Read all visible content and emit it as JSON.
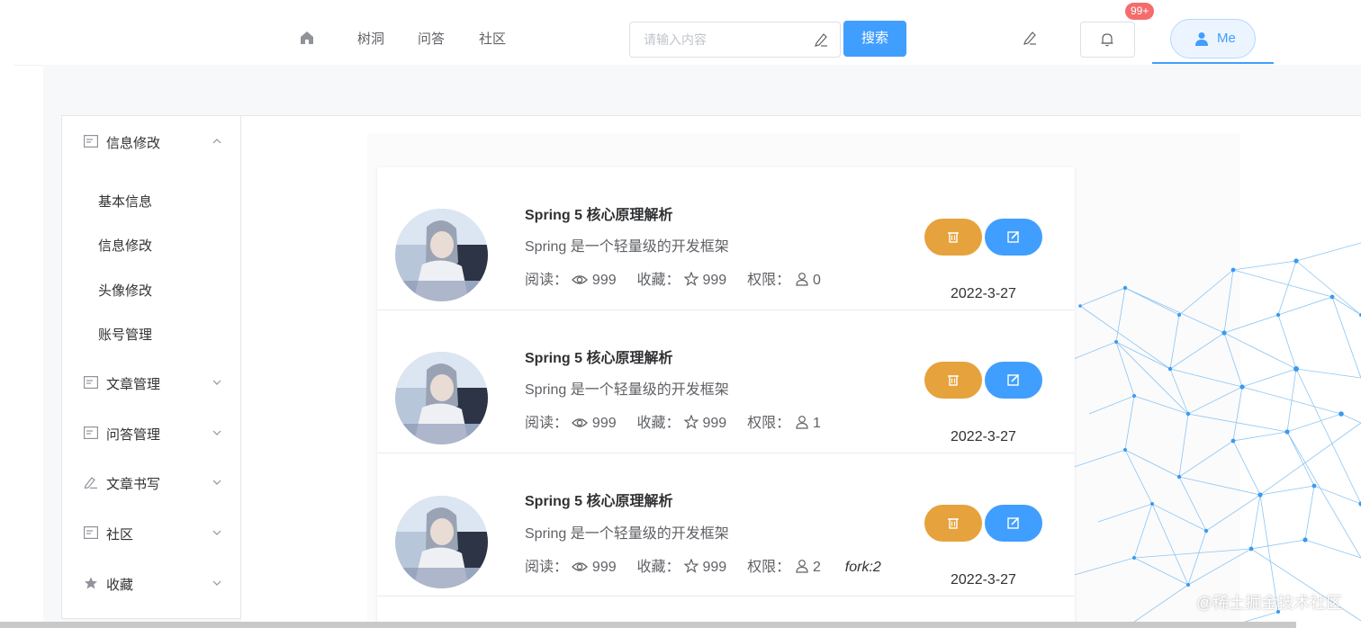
{
  "nav": {
    "home_icon": "home-icon",
    "links": [
      "树洞",
      "问答",
      "社区"
    ],
    "search_placeholder": "请输入内容",
    "search_button": "搜索",
    "notification_badge": "99+",
    "user_button": "Me"
  },
  "sidebar": {
    "groups": [
      {
        "label": "信息修改",
        "icon": "document-icon",
        "expanded": true,
        "items": [
          "基本信息",
          "信息修改",
          "头像修改",
          "账号管理"
        ]
      },
      {
        "label": "文章管理",
        "icon": "document-icon"
      },
      {
        "label": "问答管理",
        "icon": "document-icon"
      },
      {
        "label": "文章书写",
        "icon": "pen-icon"
      },
      {
        "label": "社区",
        "icon": "document-icon"
      },
      {
        "label": "收藏",
        "icon": "star-icon"
      }
    ]
  },
  "articles": [
    {
      "title": "Spring 5 核心原理解析",
      "desc": "Spring 是一个轻量级的开发框架",
      "read_label": "阅读：",
      "reads": "999",
      "fav_label": "收藏：",
      "favs": "999",
      "perm_label": "权限：",
      "perm": "0",
      "fork": "",
      "date": "2022-3-27"
    },
    {
      "title": "Spring 5 核心原理解析",
      "desc": "Spring 是一个轻量级的开发框架",
      "read_label": "阅读：",
      "reads": "999",
      "fav_label": "收藏：",
      "favs": "999",
      "perm_label": "权限：",
      "perm": "1",
      "fork": "",
      "date": "2022-3-27"
    },
    {
      "title": "Spring 5 核心原理解析",
      "desc": "Spring 是一个轻量级的开发框架",
      "read_label": "阅读：",
      "reads": "999",
      "fav_label": "收藏：",
      "favs": "999",
      "perm_label": "权限：",
      "perm": "2",
      "fork": "fork:2",
      "date": "2022-3-27"
    }
  ],
  "watermark": "@稀土掘金技术社区",
  "colors": {
    "primary": "#409eff",
    "warning": "#e6a23c",
    "danger": "#f56c6c"
  }
}
